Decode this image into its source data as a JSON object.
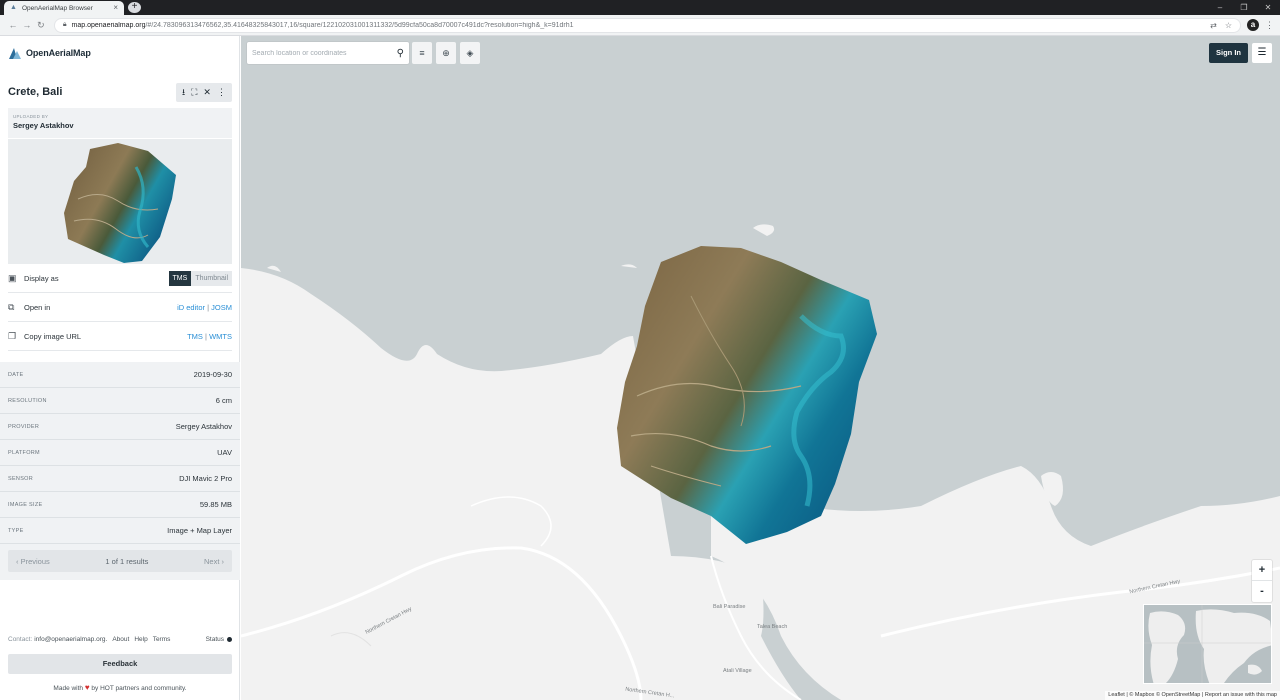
{
  "browser": {
    "tab_title": "OpenAerialMap Browser",
    "url_host": "map.openaerialmap.org",
    "url_path": "/#/24.783096313476562,35.41648325843017,16/square/12210203100131133​2/5d99cfa50ca8d70007c491dc?resolution=high&_k=91drh1"
  },
  "app": {
    "brand": "OpenAerialMap",
    "image_title": "Crete, Bali",
    "uploaded_by_label": "UPLOADED BY",
    "uploaded_by": "Sergey Astakhov",
    "display_as_label": "Display as",
    "display_options": [
      "TMS",
      "Thumbnail"
    ],
    "open_in_label": "Open in",
    "open_in_links": [
      "iD editor",
      "JOSM"
    ],
    "copy_url_label": "Copy image URL",
    "copy_url_links": [
      "TMS",
      "WMTS"
    ],
    "link_separator": "|",
    "metadata": [
      {
        "key": "DATE",
        "value": "2019-09-30"
      },
      {
        "key": "RESOLUTION",
        "value": "6 cm"
      },
      {
        "key": "PROVIDER",
        "value": "Sergey Astakhov"
      },
      {
        "key": "PLATFORM",
        "value": "UAV"
      },
      {
        "key": "SENSOR",
        "value": "DJI Mavic 2 Pro"
      },
      {
        "key": "IMAGE SIZE",
        "value": "59.85 MB"
      },
      {
        "key": "TYPE",
        "value": "Image + Map Layer"
      }
    ],
    "pager": {
      "previous": "Previous",
      "summary": "1 of 1 results",
      "next": "Next"
    },
    "footer": {
      "contact_label": "Contact:",
      "contact_email": "info@openaerialmap.org.",
      "links": [
        "About",
        "Help",
        "Terms"
      ],
      "status": "Status",
      "feedback": "Feedback",
      "made_prefix": "Made with",
      "made_suffix": "by HOT partners and community."
    }
  },
  "map": {
    "search_placeholder": "Search location or coordinates",
    "sign_in": "Sign In",
    "zoom_in": "+",
    "zoom_out": "-",
    "labels": [
      "Northern Cretan Hwy",
      "Northern Cretan Hwy",
      "Bali Paradise",
      "Talea Beach",
      "Atali Village",
      "Northern Cretan H..."
    ],
    "attribution": "Leaflet | © Mapbox © OpenStreetMap | Report an issue with this map"
  },
  "colors": {
    "sea": "#c9d0d2",
    "land": "#f2f2f2",
    "accent_dark": "#1f3440",
    "link": "#2a8fd6"
  },
  "icons": {
    "download": "download-icon",
    "fit": "fit-bounds-icon",
    "close": "close-icon",
    "more": "more-vertical-icon",
    "filter": "filter-icon",
    "locate": "locate-icon",
    "layers": "layers-icon"
  }
}
